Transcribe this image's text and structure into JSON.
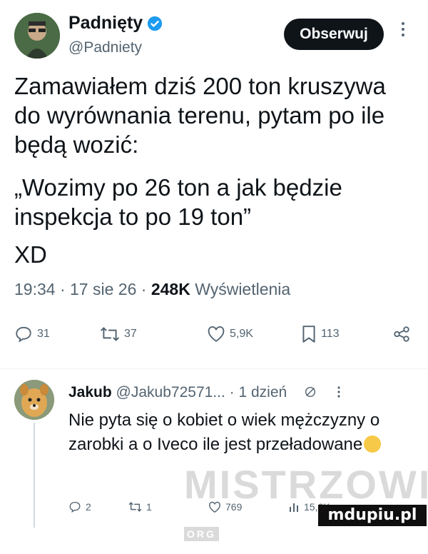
{
  "tweet": {
    "display_name": "Padnięty",
    "handle": "@Padniety",
    "follow_label": "Obserwuj",
    "paragraph1": "Zamawiałem dziś 200 ton kruszywa do wyrównania terenu, pytam po ile będą wozić:",
    "paragraph2": "„Wozimy po 26 ton a jak będzie inspekcja to po 19 ton”",
    "paragraph3": "XD",
    "time": "19:34",
    "date": "17 sie 26",
    "views_count": "248K",
    "views_label": "Wyświetlenia",
    "stats": {
      "replies": "31",
      "retweets": "37",
      "likes": "5,9K",
      "bookmarks": "113"
    }
  },
  "reply": {
    "name": "Jakub",
    "handle_time": "@Jakub72571... · 1 dzień",
    "text": "Nie pyta się o kobiet o wiek mężczyzny o zarobki a o Iveco ile jest przeładowane",
    "stats": {
      "replies": "2",
      "retweets": "1",
      "likes": "769",
      "views": "15,6K"
    }
  },
  "watermark": "MISTRZOWIE",
  "watermark_badge": "ORG",
  "site_badge": "mdupiu.pl",
  "colors": {
    "text": "#0f1419",
    "secondary": "#536471",
    "verified": "#1d9bf0",
    "button": "#0f1419"
  },
  "icons": [
    "verified-badge-icon",
    "more-icon",
    "reply-icon",
    "retweet-icon",
    "like-icon",
    "bookmark-icon",
    "share-icon",
    "grok-icon",
    "views-icon"
  ]
}
